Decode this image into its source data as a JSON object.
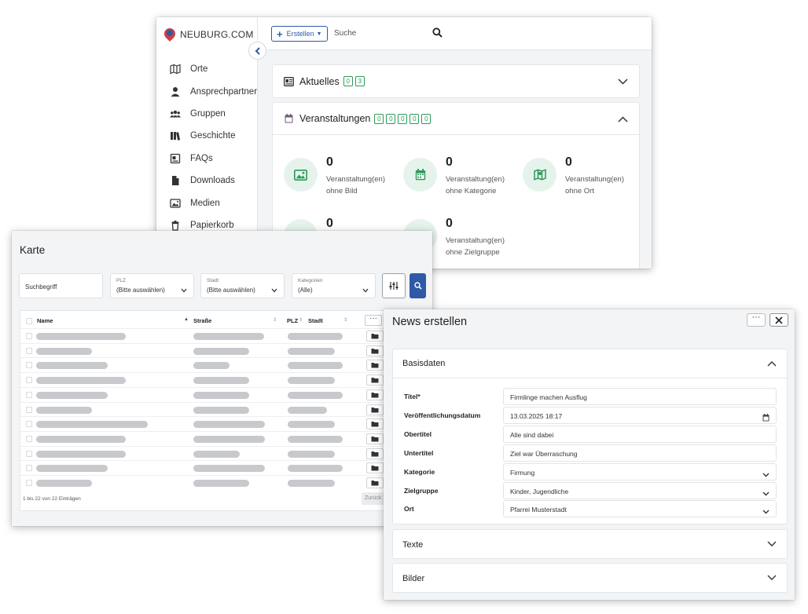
{
  "main": {
    "brand": "NEUBURG.COM",
    "nav": [
      "Orte",
      "Ansprechpartner",
      "Gruppen",
      "Geschichte",
      "FAQs",
      "Downloads",
      "Medien",
      "Papierkorb"
    ],
    "create_label": "Erstellen",
    "search_placeholder": "Suche",
    "aktuelles": {
      "title": "Aktuelles",
      "badges": [
        "0",
        "3"
      ]
    },
    "veranstaltungen": {
      "title": "Veranstaltungen",
      "badges": [
        "0",
        "0",
        "0",
        "0",
        "0"
      ],
      "stats": [
        {
          "num": "0",
          "line1": "Veranstaltung(en)",
          "line2": "ohne Bild",
          "icon": "image-icon"
        },
        {
          "num": "0",
          "line1": "Veranstaltung(en)",
          "line2": "ohne Kategorie",
          "icon": "calendar-icon"
        },
        {
          "num": "0",
          "line1": "Veranstaltung(en)",
          "line2": "ohne Ort",
          "icon": "map-icon"
        },
        {
          "num": "0",
          "line1": "",
          "line2": "",
          "icon": ""
        },
        {
          "num": "0",
          "line1": "Veranstaltung(en)",
          "line2": "ohne Zielgruppe",
          "icon": ""
        }
      ]
    }
  },
  "karte": {
    "title": "Karte",
    "search_placeholder": "Suchbegriff",
    "filters": [
      {
        "label": "PLZ",
        "value": "(Bitte auswählen)"
      },
      {
        "label": "Stadt",
        "value": "(Bitte auswählen)"
      },
      {
        "label": "Kategorien",
        "value": "(Alle)"
      }
    ],
    "columns": [
      "Name",
      "Straße",
      "PLZ",
      "Stadt"
    ],
    "row_count": 11,
    "pager": "1 bis 22 von 22 Einträgen",
    "back_label": "Zurück"
  },
  "news": {
    "title": "News erstellen",
    "sections": {
      "basis": "Basisdaten",
      "texte": "Texte",
      "bilder": "Bilder"
    },
    "fields": [
      {
        "label": "Titel*",
        "value": "Firmlinge machen Ausflug",
        "type": "text"
      },
      {
        "label": "Veröffentlichungsdatum",
        "value": "13.03.2025 18:17",
        "type": "date"
      },
      {
        "label": "Obertitel",
        "value": "Alle sind dabei",
        "type": "text"
      },
      {
        "label": "Untertitel",
        "value": "Ziel war Überraschung",
        "type": "text"
      },
      {
        "label": "Kategorie",
        "value": "Firmung",
        "type": "select"
      },
      {
        "label": "Zielgruppe",
        "value": "Kinder, Jugendliche",
        "type": "select"
      },
      {
        "label": "Ort",
        "value": "Pfarrei Musterstadt",
        "type": "select"
      }
    ]
  },
  "colors": {
    "accent": "#2e5aa8",
    "green": "#2b9a58",
    "circle_bg": "#e6f3ec"
  }
}
